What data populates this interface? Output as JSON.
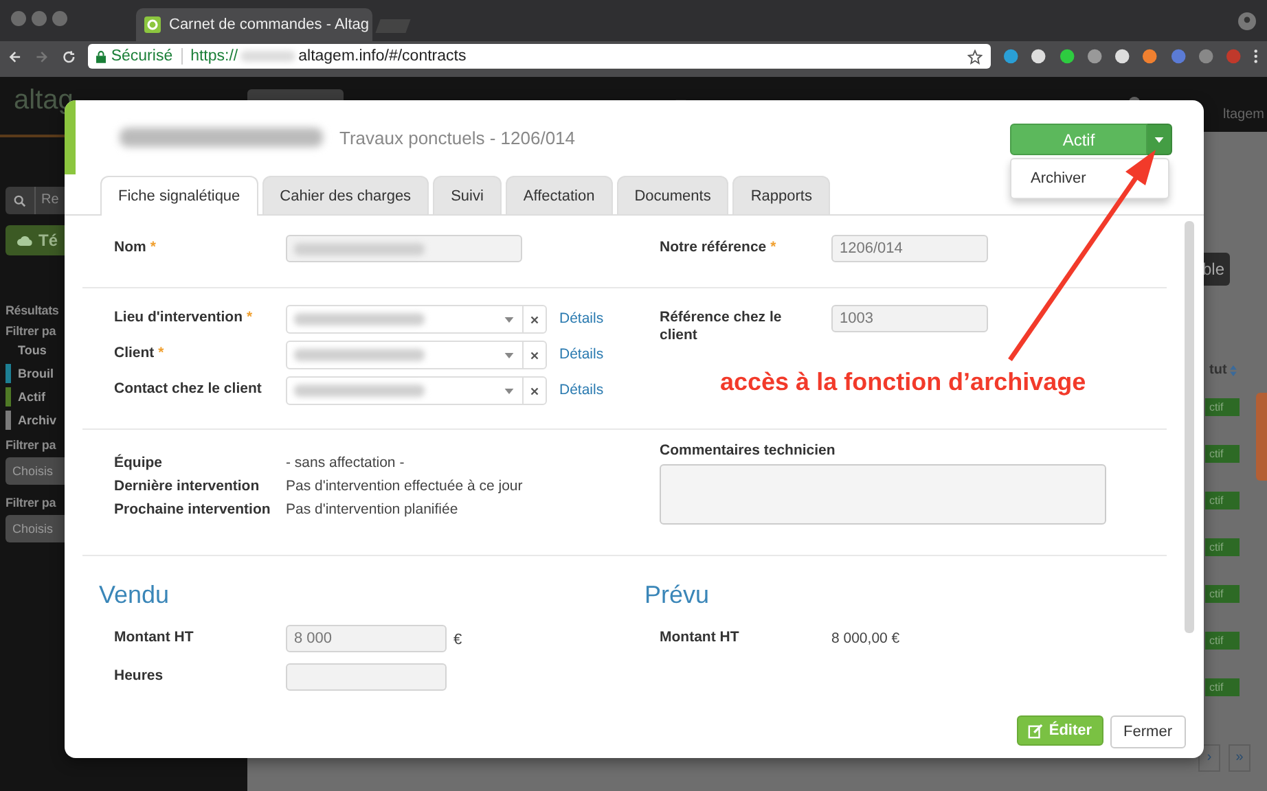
{
  "browser": {
    "tab_title": "Carnet de commandes - Altag",
    "secure_label": "Sécurisé",
    "url_scheme": "https://",
    "url_rest": "altagem.info/#/contracts"
  },
  "app_bar": {
    "logo": "altag",
    "user": "ltagem"
  },
  "sidebar": {
    "search_placeholder": "Re",
    "import_button": "Té",
    "results_label": "Résultats",
    "filter_label": "Filtrer pa",
    "statuses": [
      {
        "label": "Tous"
      },
      {
        "label": "Brouil",
        "color": "#1d7f93"
      },
      {
        "label": "Actif",
        "color": "#4f7a26"
      },
      {
        "label": "Archiv",
        "color": "#7a7a7a"
      }
    ],
    "extra_filters": [
      {
        "label": "Filtrer pa",
        "placeholder": "Choisis"
      },
      {
        "label": "Filtrer pa",
        "placeholder": "Choisis"
      }
    ]
  },
  "list": {
    "button": "ble",
    "status_header": "tut",
    "badges": [
      "ctif",
      "ctif",
      "ctif",
      "ctif",
      "ctif",
      "ctif",
      "ctif"
    ],
    "pagination": [
      "›",
      "»"
    ]
  },
  "modal": {
    "title": "Travaux ponctuels - 1206/014",
    "status_button": "Actif",
    "status_menu": [
      "Archiver"
    ],
    "tabs": [
      {
        "label": "Fiche signalétique",
        "selected": true
      },
      {
        "label": "Cahier des charges",
        "selected": false
      },
      {
        "label": "Suivi",
        "selected": false
      },
      {
        "label": "Affectation",
        "selected": false
      },
      {
        "label": "Documents",
        "selected": false
      },
      {
        "label": "Rapports",
        "selected": false
      }
    ],
    "sections": [
      {
        "left": [
          {
            "kind": "text",
            "label": "Nom",
            "required_mark": "*",
            "redacted": true
          }
        ],
        "right": [
          {
            "kind": "text",
            "label": "Notre référence",
            "required_mark": "*",
            "value": "1206/014"
          }
        ]
      },
      {
        "left": [
          {
            "kind": "select",
            "label": "Lieu d'intervention",
            "required_mark": "*",
            "redacted": true,
            "link": "Détails"
          },
          {
            "kind": "select",
            "label": "Client",
            "required_mark": "*",
            "redacted": true,
            "link": "Détails"
          },
          {
            "kind": "select",
            "label": "Contact chez le client",
            "redacted": true,
            "link": "Détails"
          }
        ],
        "right": [
          {
            "kind": "text",
            "label": "Référence chez le client",
            "value": "1003"
          }
        ]
      },
      {
        "left": [
          {
            "kind": "static",
            "label": "Équipe",
            "value": "- sans affectation -"
          },
          {
            "kind": "static",
            "label": "Dernière intervention",
            "value": "Pas d'intervention effectuée à ce jour"
          },
          {
            "kind": "static",
            "label": "Prochaine intervention",
            "value": "Pas d'intervention planifiée"
          }
        ],
        "right": [
          {
            "kind": "textarea",
            "label": "Commentaires technicien"
          }
        ]
      }
    ],
    "money": [
      {
        "heading": "Vendu",
        "rows": [
          {
            "kind": "text",
            "label": "Montant HT",
            "value": "8 000",
            "unit": "€"
          },
          {
            "kind": "text",
            "label": "Heures"
          }
        ]
      },
      {
        "heading": "Prévu",
        "rows": [
          {
            "kind": "static",
            "label": "Montant HT",
            "value": "8 000,00 €"
          }
        ]
      }
    ],
    "edit_button": "Éditer",
    "close_button": "Fermer"
  },
  "annotation": "accès à la fonction d’archivage"
}
